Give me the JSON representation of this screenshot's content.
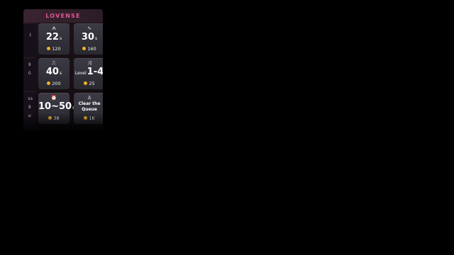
{
  "panel": {
    "brand": "LOVENSE",
    "rail": [
      "i",
      "8",
      "G",
      "ss",
      "8",
      "ω"
    ],
    "tiles": [
      {
        "icon": "ᗑ",
        "icon_name": "pulse-up-icon",
        "value": "22",
        "unit": "s",
        "price": "120"
      },
      {
        "icon": "∿",
        "icon_name": "wave-icon",
        "value": "30",
        "unit": "s",
        "price": "160"
      },
      {
        "icon": "⎍",
        "icon_name": "square-wave-icon",
        "value": "40",
        "unit": "s",
        "price": "200"
      },
      {
        "icon": "⤨",
        "icon_name": "shuffle-icon",
        "prefix": "Level",
        "value": "1-4",
        "price": "25"
      },
      {
        "icon": "⏰",
        "icon_name": "alarm-clock-icon",
        "value": "10~50",
        "unit": "s",
        "price": "38"
      },
      {
        "icon": "♙",
        "icon_name": "queue-icon",
        "line1": "Clear the",
        "line2": "Queue",
        "price": "1K"
      }
    ]
  },
  "colors": {
    "brand": "#e0569a",
    "coin": "#f0b429",
    "background": "#000000"
  }
}
